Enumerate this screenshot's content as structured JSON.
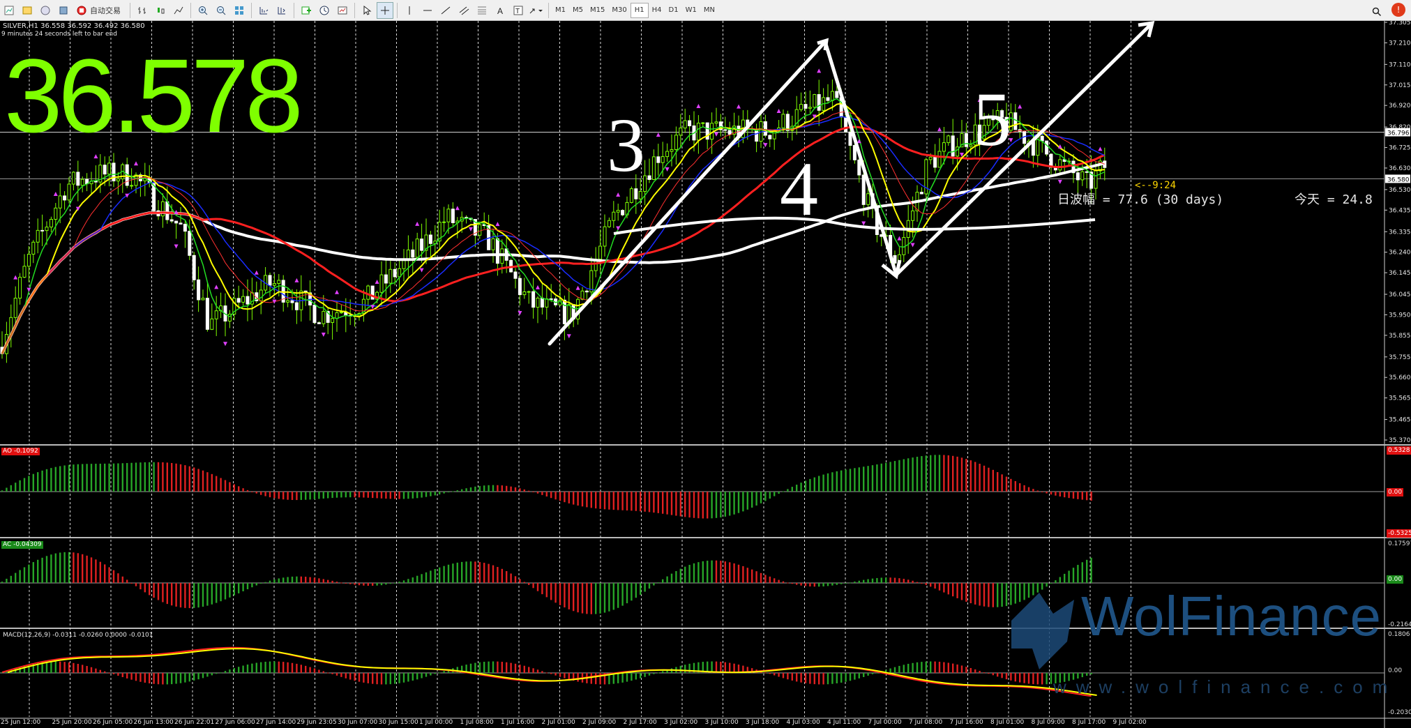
{
  "toolbar": {
    "auto_trading_label": "自动交易",
    "timeframes": [
      "M1",
      "M5",
      "M15",
      "M30",
      "H1",
      "H4",
      "D1",
      "W1",
      "MN"
    ]
  },
  "chart": {
    "symbol_line": "SILVER,H1  36.558 36.592 36.492 36.580",
    "countdown_line": "9 minutes 24 seconds left to bar end",
    "big_price": "36.578",
    "bar_timer": "<--9:24",
    "daily_range_text": "日波幅 = 77.6  (30 days)",
    "today_text": "今天 = 24.8",
    "current_price_badge": "36.580",
    "line_price_badge": "36.796",
    "price_ticks": [
      "37.305",
      "37.210",
      "37.110",
      "37.015",
      "36.920",
      "36.820",
      "36.725",
      "36.630",
      "36.530",
      "36.435",
      "36.335",
      "36.240",
      "36.145",
      "36.045",
      "35.950",
      "35.855",
      "35.755",
      "35.660",
      "35.565",
      "35.465",
      "35.370"
    ],
    "time_labels": [
      "25 Jun 12:00",
      "25 Jun 20:00",
      "26 Jun 05:00",
      "26 Jun 13:00",
      "26 Jun 22:01",
      "27 Jun 06:00",
      "27 Jun 14:00",
      "29 Jun 23:05",
      "30 Jun 07:00",
      "30 Jun 15:00",
      "1 Jul 00:00",
      "1 Jul 08:00",
      "1 Jul 16:00",
      "2 Jul 01:00",
      "2 Jul 09:00",
      "2 Jul 17:00",
      "3 Jul 02:00",
      "3 Jul 10:00",
      "3 Jul 18:00",
      "4 Jul 03:00",
      "4 Jul 11:00",
      "7 Jul 00:00",
      "7 Jul 08:00",
      "7 Jul 16:00",
      "8 Jul 01:00",
      "8 Jul 09:00",
      "8 Jul 17:00",
      "9 Jul 02:00"
    ],
    "wave_labels": [
      "3",
      "4",
      "5"
    ],
    "accent_colors": {
      "price": "#7fff00",
      "up_bar": "#27a527",
      "down_bar": "#e02020",
      "ma_white": "#ffffff",
      "ma_red": "#ff2020",
      "ma_blue": "#1a2cff",
      "ma_yellow": "#ffff00",
      "ma_green": "#22dd22"
    }
  },
  "indicators": {
    "ao": {
      "label": "AO -0.1092",
      "top": "0.5328",
      "zero": "0.00",
      "bottom": "-0.5325"
    },
    "ac": {
      "label": "AC -0.04309",
      "top": "0.17597",
      "zero": "0.00",
      "bottom": "-0.21643"
    },
    "macd": {
      "label": "MACD(12,26,9) -0.0311 -0.0260 0.0000 -0.0101",
      "top": "0.1806",
      "zero": "0.00",
      "bottom": "-0.2030"
    }
  },
  "watermark": {
    "name": "WolFinance",
    "url": "www.wolfinance.com"
  }
}
